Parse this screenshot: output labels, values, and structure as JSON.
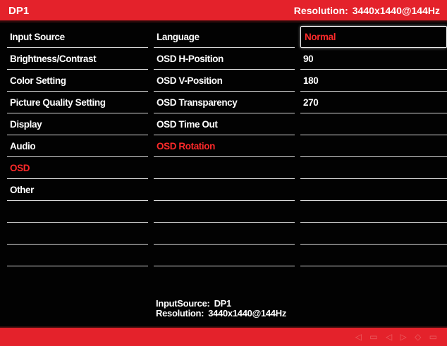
{
  "header": {
    "input": "DP1",
    "resolution_label": "Resolution:",
    "resolution_value": "3440x1440@144Hz"
  },
  "main_menu": [
    {
      "label": "Input Source",
      "active": false
    },
    {
      "label": "Brightness/Contrast",
      "active": false
    },
    {
      "label": "Color Setting",
      "active": false
    },
    {
      "label": "Picture Quality Setting",
      "active": false
    },
    {
      "label": "Display",
      "active": false
    },
    {
      "label": "Audio",
      "active": false
    },
    {
      "label": "OSD",
      "active": true
    },
    {
      "label": "Other",
      "active": false
    }
  ],
  "sub_menu": [
    {
      "label": "Language",
      "active": false
    },
    {
      "label": "OSD H-Position",
      "active": false
    },
    {
      "label": "OSD V-Position",
      "active": false
    },
    {
      "label": "OSD Transparency",
      "active": false
    },
    {
      "label": "OSD Time Out",
      "active": false
    },
    {
      "label": "OSD Rotation",
      "active": true
    }
  ],
  "options": [
    {
      "label": "Normal",
      "selected": true
    },
    {
      "label": "90",
      "selected": false
    },
    {
      "label": "180",
      "selected": false
    },
    {
      "label": "270",
      "selected": false
    }
  ],
  "footer": {
    "input_label": "InputSource:",
    "input_value": "DP1",
    "resolution_label": "Resolution:",
    "resolution_value": "3440x1440@144Hz"
  },
  "colors": {
    "accent": "#e4222b",
    "highlight_text": "#ff2a2a",
    "background": "#020202"
  }
}
